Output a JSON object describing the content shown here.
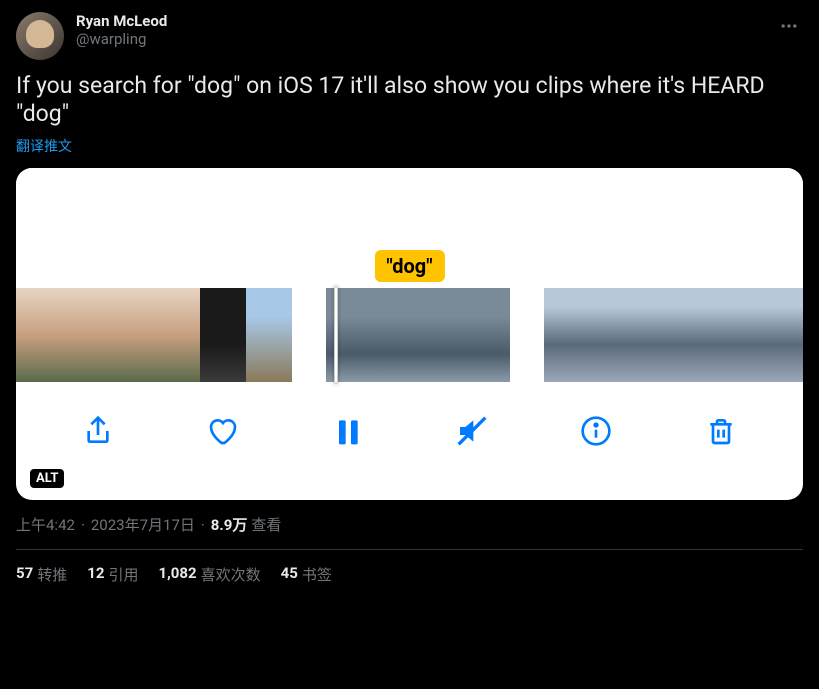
{
  "user": {
    "display_name": "Ryan McLeod",
    "username": "@warpling"
  },
  "tweet_text": "If you search for \"dog\" on iOS 17 it'll also show you clips where it's HEARD \"dog\"",
  "translate_label": "翻译推文",
  "media": {
    "caption_keyword": "\"dog\"",
    "alt_badge": "ALT"
  },
  "toolbar": {
    "share": "share",
    "like": "like",
    "pause": "pause",
    "mute": "mute",
    "info": "info",
    "trash": "trash"
  },
  "meta": {
    "time": "上午4:42",
    "date": "2023年7月17日",
    "views_count": "8.9万",
    "views_label": "查看"
  },
  "stats": {
    "retweets_count": "57",
    "retweets_label": "转推",
    "quotes_count": "12",
    "quotes_label": "引用",
    "likes_count": "1,082",
    "likes_label": "喜欢次数",
    "bookmarks_count": "45",
    "bookmarks_label": "书签"
  }
}
